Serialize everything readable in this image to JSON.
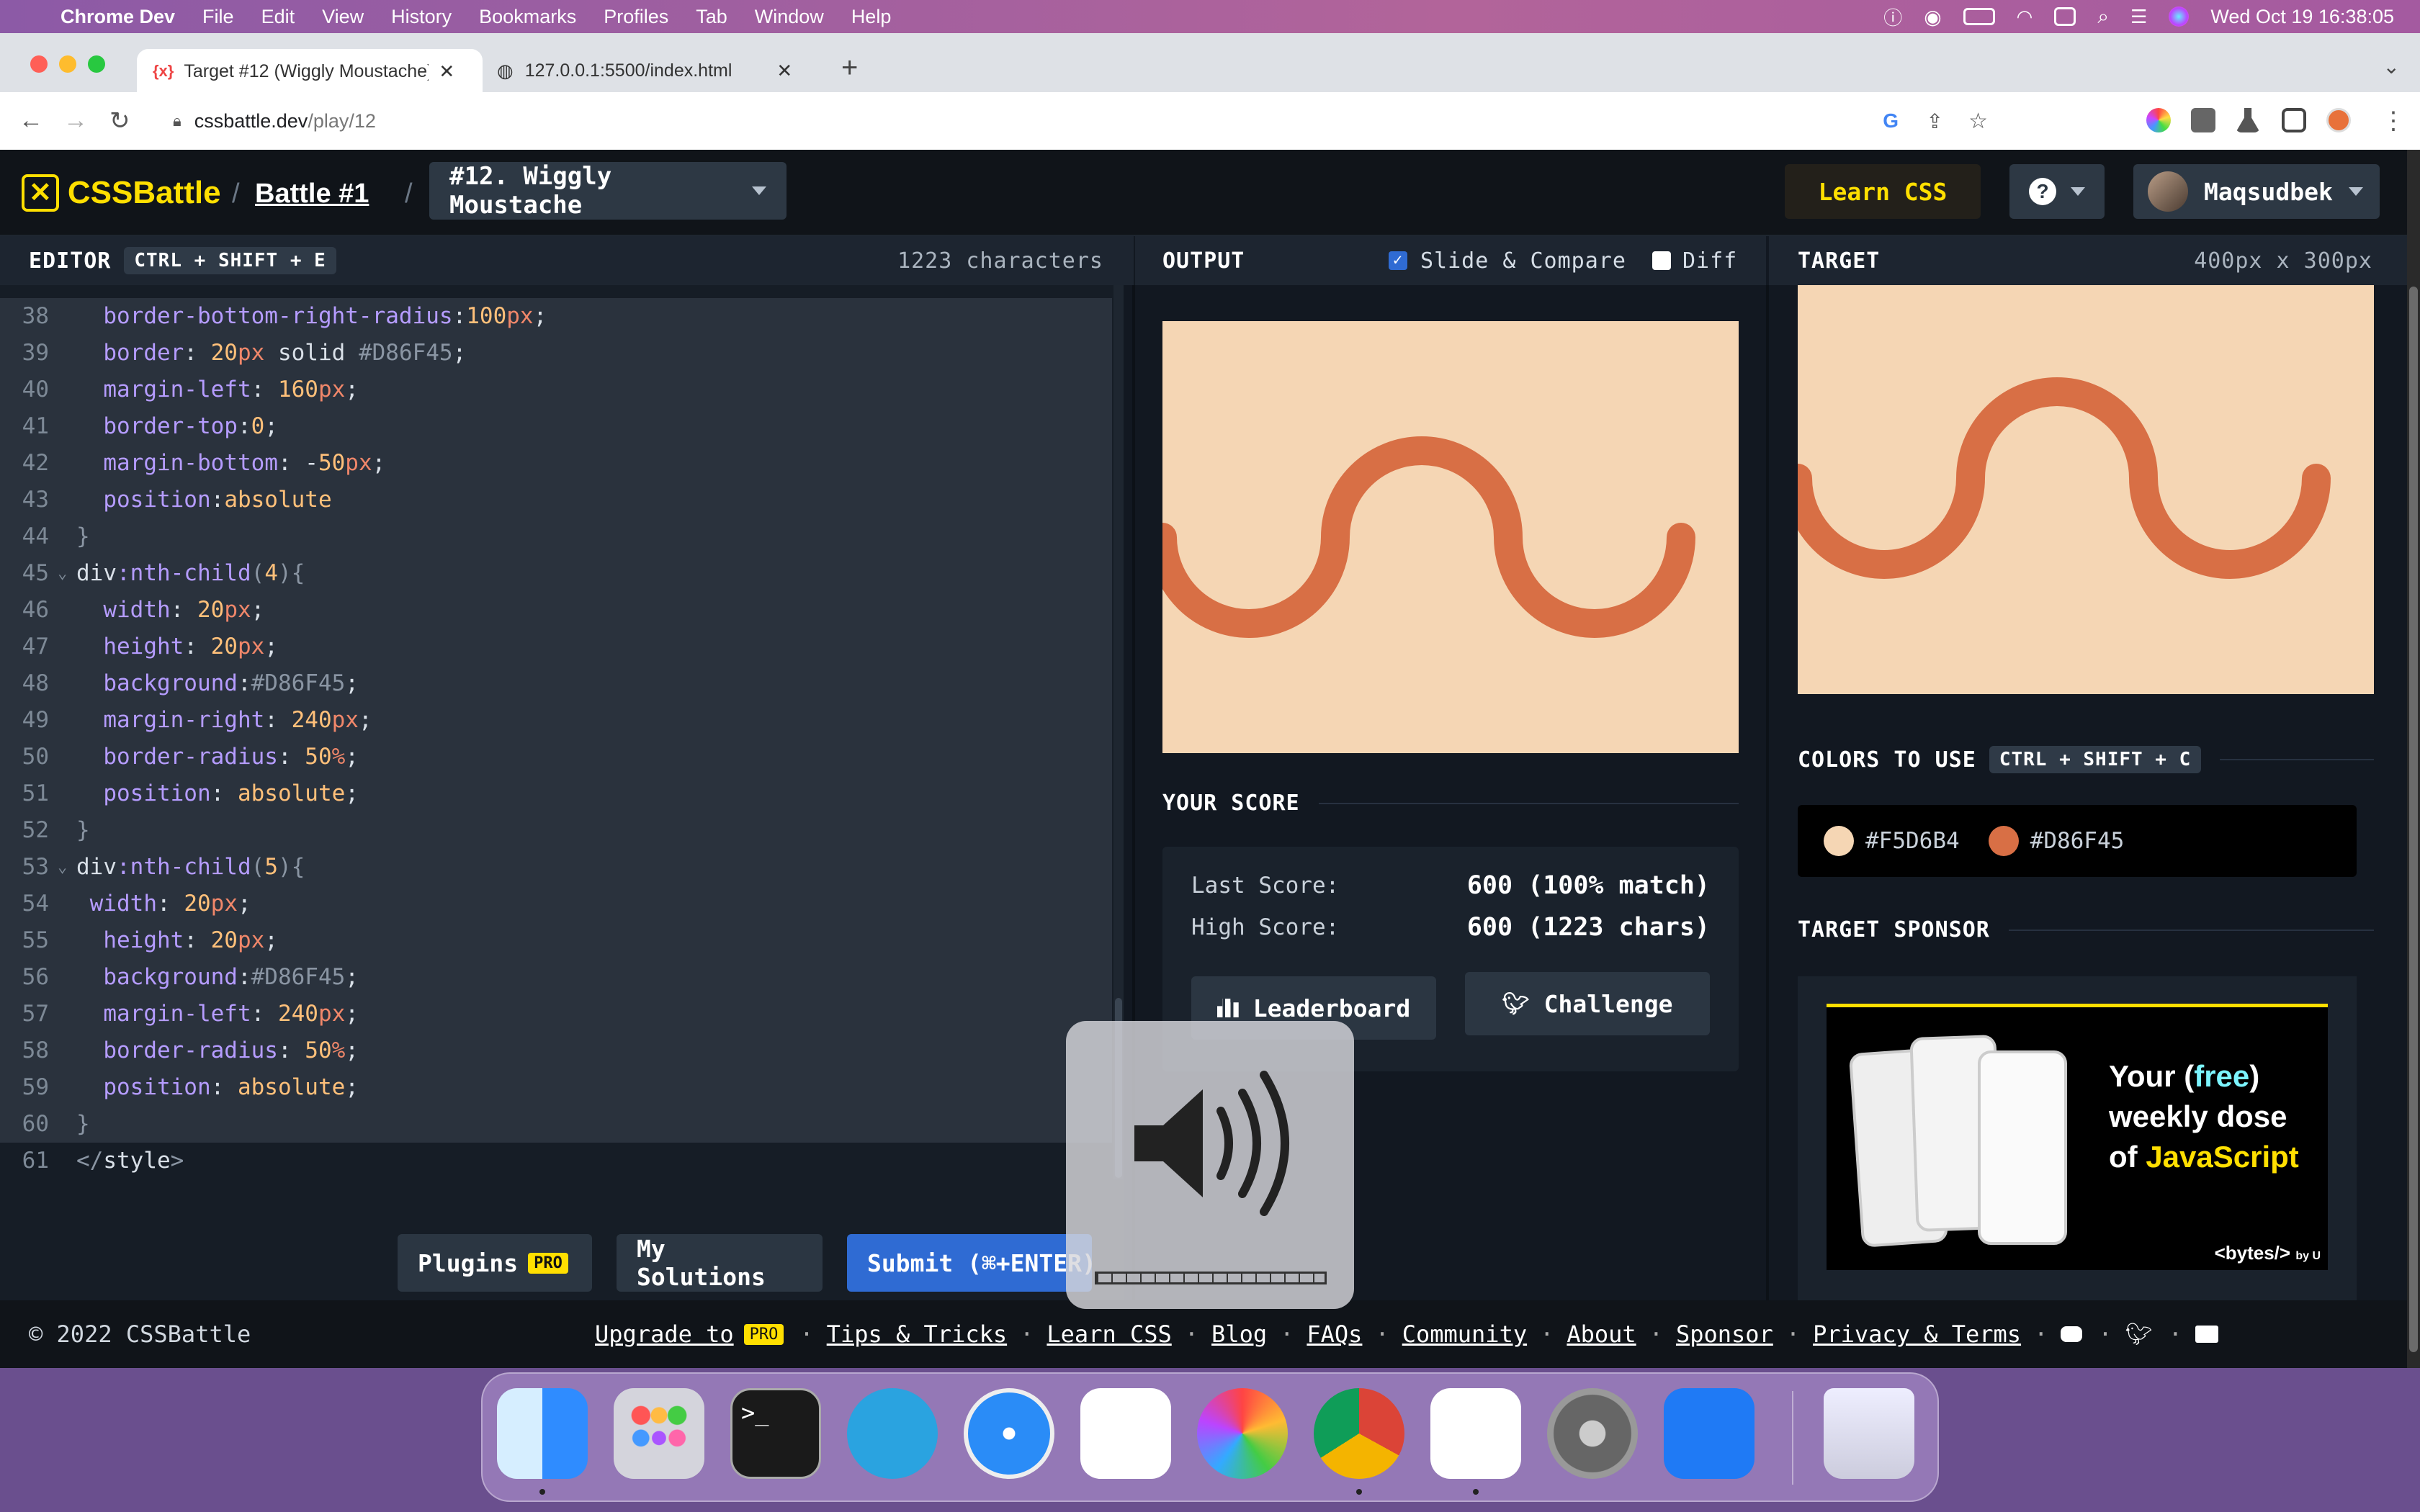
{
  "menubar": {
    "app": "Chrome Dev",
    "items": [
      "File",
      "Edit",
      "View",
      "History",
      "Bookmarks",
      "Profiles",
      "Tab",
      "Window",
      "Help"
    ],
    "datetime": "Wed Oct 19  16:38:05"
  },
  "browser": {
    "tabs": [
      {
        "title": "Target #12 (Wiggly Moustache)"
      },
      {
        "title": "127.0.0.1:5500/index.html"
      }
    ],
    "url_host": "cssbattle.dev",
    "url_path": "/play/12"
  },
  "header": {
    "logo": "CSSBattle",
    "battle": "Battle #1",
    "target_select": "#12. Wiggly Moustache",
    "learn_css": "Learn CSS",
    "help": "?",
    "username": "Maqsudbek"
  },
  "editor": {
    "title": "EDITOR",
    "shortcut": "CTRL + SHIFT + E",
    "char_count": "1223 characters",
    "lines": [
      {
        "n": "38",
        "html": "  <span class='p'>border-bottom-right-radius</span><span class='t'>:</span><span class='v'>100</span><span class='u'>px</span><span class='t'>;</span>"
      },
      {
        "n": "39",
        "html": "  <span class='p'>border</span><span class='t'>: </span><span class='v'>20</span><span class='u'>px</span><span class='t'> solid </span><span class='c'>#D86F45</span><span class='t'>;</span>"
      },
      {
        "n": "40",
        "html": "  <span class='p'>margin-left</span><span class='t'>: </span><span class='v'>160</span><span class='u'>px</span><span class='t'>;</span>"
      },
      {
        "n": "41",
        "html": "  <span class='p'>border-top</span><span class='t'>:</span><span class='v'>0</span><span class='t'>;</span>"
      },
      {
        "n": "42",
        "html": "  <span class='p'>margin-bottom</span><span class='t'>: -</span><span class='v'>50</span><span class='u'>px</span><span class='t'>;</span>"
      },
      {
        "n": "43",
        "html": "  <span class='p'>position</span><span class='t'>:</span><span class='v'>absolute</span>"
      },
      {
        "n": "44",
        "html": "<span class='c'>}</span>"
      },
      {
        "n": "45",
        "html": "<span class='t'>div</span><span class='p'>:nth-child</span><span class='c'>(</span><span class='v'>4</span><span class='c'>){</span>"
      },
      {
        "n": "46",
        "html": "  <span class='p'>width</span><span class='t'>: </span><span class='v'>20</span><span class='u'>px</span><span class='t'>;</span>"
      },
      {
        "n": "47",
        "html": "  <span class='p'>height</span><span class='t'>: </span><span class='v'>20</span><span class='u'>px</span><span class='t'>;</span>"
      },
      {
        "n": "48",
        "html": "  <span class='p'>background</span><span class='t'>:</span><span class='c'>#D86F45</span><span class='t'>;</span>"
      },
      {
        "n": "49",
        "html": "  <span class='p'>margin-right</span><span class='t'>: </span><span class='v'>240</span><span class='u'>px</span><span class='t'>;</span>"
      },
      {
        "n": "50",
        "html": "  <span class='p'>border-radius</span><span class='t'>: </span><span class='v'>50</span><span class='u'>%</span><span class='t'>;</span>"
      },
      {
        "n": "51",
        "html": "  <span class='p'>position</span><span class='t'>: </span><span class='v'>absolute</span><span class='t'>;</span>"
      },
      {
        "n": "52",
        "html": "<span class='c'>}</span>"
      },
      {
        "n": "53",
        "html": "<span class='t'>div</span><span class='p'>:nth-child</span><span class='c'>(</span><span class='v'>5</span><span class='c'>){</span>"
      },
      {
        "n": "54",
        "html": " <span class='p'>width</span><span class='t'>: </span><span class='v'>20</span><span class='u'>px</span><span class='t'>;</span>"
      },
      {
        "n": "55",
        "html": "  <span class='p'>height</span><span class='t'>: </span><span class='v'>20</span><span class='u'>px</span><span class='t'>;</span>"
      },
      {
        "n": "56",
        "html": "  <span class='p'>background</span><span class='t'>:</span><span class='c'>#D86F45</span><span class='t'>;</span>"
      },
      {
        "n": "57",
        "html": "  <span class='p'>margin-left</span><span class='t'>: </span><span class='v'>240</span><span class='u'>px</span><span class='t'>;</span>"
      },
      {
        "n": "58",
        "html": "  <span class='p'>border-radius</span><span class='t'>: </span><span class='v'>50</span><span class='u'>%</span><span class='t'>;</span>"
      },
      {
        "n": "59",
        "html": "  <span class='p'>position</span><span class='t'>: </span><span class='v'>absolute</span><span class='t'>;</span>"
      },
      {
        "n": "60",
        "html": "<span class='c'>}</span>"
      },
      {
        "n": "61",
        "html": "<span class='c'>&lt;/</span><span class='t'>style</span><span class='c'>&gt;</span>"
      }
    ],
    "plugins": "Plugins",
    "pro": "PRO",
    "my_solutions": "My Solutions",
    "submit": "Submit (⌘+ENTER)"
  },
  "output": {
    "title": "OUTPUT",
    "slide_compare": "Slide & Compare",
    "diff": "Diff",
    "your_score": "YOUR SCORE",
    "last_score_label": "Last Score:",
    "last_score": "600 (100% match)",
    "high_score_label": "High Score:",
    "high_score": "600 (1223 chars)",
    "leaderboard": "Leaderboard",
    "challenge": "Challenge"
  },
  "target": {
    "title": "TARGET",
    "size": "400px x 300px",
    "colors_title": "COLORS TO USE",
    "colors_shortcut": "CTRL + SHIFT + C",
    "colors": [
      {
        "hex": "#F5D6B4"
      },
      {
        "hex": "#D86F45"
      }
    ],
    "sponsor_title": "TARGET SPONSOR",
    "sponsor_line1a": "Your (",
    "sponsor_free": "free",
    "sponsor_line1b": ")",
    "sponsor_line2": "weekly dose",
    "sponsor_line3a": "of ",
    "sponsor_js": "JavaScript",
    "sponsor_brand": "<bytes/>",
    "sponsor_by": "by U"
  },
  "footer": {
    "copyright": "© 2022 CSSBattle",
    "links": [
      "Upgrade to",
      "Tips & Tricks",
      "Learn CSS",
      "Blog",
      "FAQs",
      "Community",
      "About",
      "Sponsor",
      "Privacy & Terms"
    ]
  },
  "dock": {
    "apps": [
      "finder-icon",
      "launchpad-icon",
      "terminal-icon",
      "telegram-icon",
      "safari-icon",
      "slack-icon",
      "pixelmator-icon",
      "chrome-dev-icon",
      "vscode-icon",
      "system-preferences-icon",
      "xcode-instruments-icon",
      "trash-icon"
    ]
  },
  "colors": {
    "bg_beige": "#F5D6B4",
    "shape_orange": "#D86F45",
    "app_bg": "#121821",
    "accent_yellow": "#FFDF00",
    "submit_blue": "#2f6bd3"
  }
}
